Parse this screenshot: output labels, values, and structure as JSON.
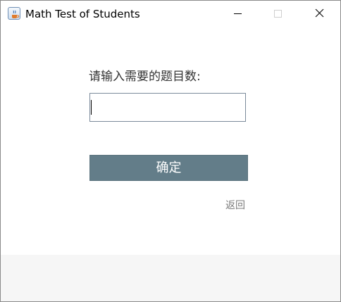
{
  "window": {
    "title": "Math Test of Students",
    "controls": [
      {
        "name": "minimize",
        "icon": "minimize-icon"
      },
      {
        "name": "maximize",
        "icon": "maximize-icon"
      },
      {
        "name": "close",
        "icon": "close-icon"
      }
    ],
    "app_icon": "java-cup-icon"
  },
  "form": {
    "prompt": "请输入需要的题目数:",
    "input_value": "",
    "confirm_label": "确定",
    "back_label": "返回"
  },
  "colors": {
    "button_bg": "#637d89",
    "button_text": "#ffffff",
    "link_text": "#7a7a7a",
    "footer_bg": "#f6f6f6"
  }
}
